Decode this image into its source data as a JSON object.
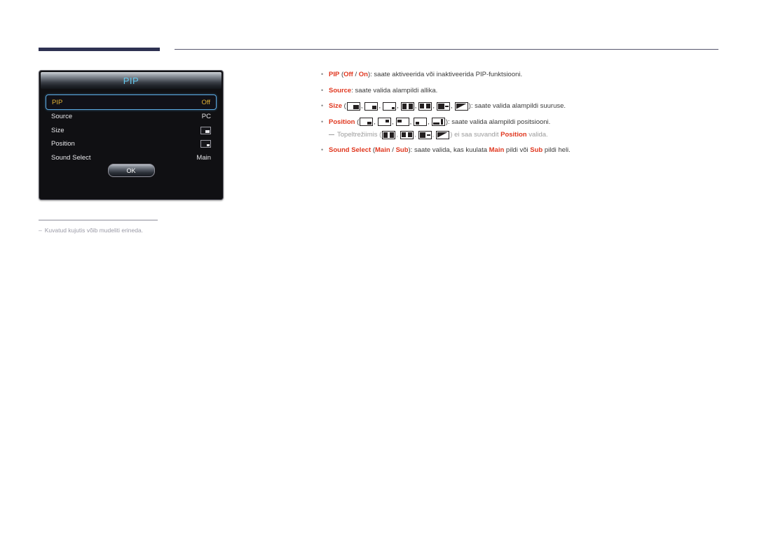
{
  "page": {
    "language_note": "Estonian user manual page for Samsung display PIP menu"
  },
  "osd": {
    "title": "PIP",
    "rows": [
      {
        "label": "PIP",
        "value": "Off",
        "value_type": "text",
        "selected": true
      },
      {
        "label": "Source",
        "value": "PC",
        "value_type": "text",
        "selected": false
      },
      {
        "label": "Size",
        "value": "",
        "value_type": "icon-br",
        "selected": false
      },
      {
        "label": "Position",
        "value": "",
        "value_type": "icon-br-small",
        "selected": false
      },
      {
        "label": "Sound Select",
        "value": "Main",
        "value_type": "text",
        "selected": false
      }
    ],
    "ok_button": "OK"
  },
  "footnote": {
    "dash": "–",
    "text": "Kuvatud kujutis võib mudeliti erineda."
  },
  "content": {
    "bullet_char": "•",
    "items": [
      {
        "id": "pip",
        "segments": [
          {
            "type": "bold-red",
            "text": "PIP"
          },
          {
            "type": "plain",
            "text": " ("
          },
          {
            "type": "bold-red",
            "text": "Off"
          },
          {
            "type": "plain",
            "text": " / "
          },
          {
            "type": "bold-red",
            "text": "On"
          },
          {
            "type": "plain",
            "text": "): saate aktiveerida või inaktiveerida PIP-funktsiooni."
          }
        ]
      },
      {
        "id": "source",
        "segments": [
          {
            "type": "bold-red",
            "text": "Source"
          },
          {
            "type": "plain",
            "text": ": saate valida alampildi allika."
          }
        ]
      },
      {
        "id": "size",
        "segments": [
          {
            "type": "bold-red",
            "text": "Size"
          },
          {
            "type": "plain",
            "text": " ("
          }
        ],
        "icons": [
          "size-large",
          "size-medium",
          "size-small",
          "split-even-tall",
          "split-even-short",
          "split-main-sub",
          "split-diagonal"
        ],
        "tail": "): saate valida alampildi suuruse."
      },
      {
        "id": "position",
        "segments": [
          {
            "type": "bold-red",
            "text": "Position"
          },
          {
            "type": "plain",
            "text": " ("
          }
        ],
        "icons": [
          "pos-bottom-right",
          "pos-top-right",
          "pos-top-left",
          "pos-bottom-left",
          "pos-arrow"
        ],
        "tail": "): saate valida alampildi positsiooni."
      }
    ],
    "subnote": {
      "lead": "Topeltrežiimis (",
      "icons": [
        "split-even-tall",
        "split-even-short",
        "split-main-sub",
        "split-diagonal"
      ],
      "mid": ") ei saa suvandit ",
      "highlight": "Position",
      "tail": " valida."
    },
    "sound_select": {
      "segments": [
        {
          "type": "bold-red",
          "text": "Sound Select"
        },
        {
          "type": "plain",
          "text": " ("
        },
        {
          "type": "bold-red",
          "text": "Main"
        },
        {
          "type": "plain",
          "text": " / "
        },
        {
          "type": "bold-red",
          "text": "Sub"
        },
        {
          "type": "plain",
          "text": "): saate valida, kas kuulata "
        },
        {
          "type": "bold-red",
          "text": "Main"
        },
        {
          "type": "plain",
          "text": " pildi või "
        },
        {
          "type": "bold-red",
          "text": "Sub"
        },
        {
          "type": "plain",
          "text": " pildi heli."
        }
      ]
    }
  },
  "colors": {
    "accent_red": "#e0371f",
    "rule_navy": "#2e3152",
    "osd_title_blue": "#63c8ee",
    "osd_selected_gold": "#e2b233",
    "osd_selected_border": "#5aa8e0"
  }
}
